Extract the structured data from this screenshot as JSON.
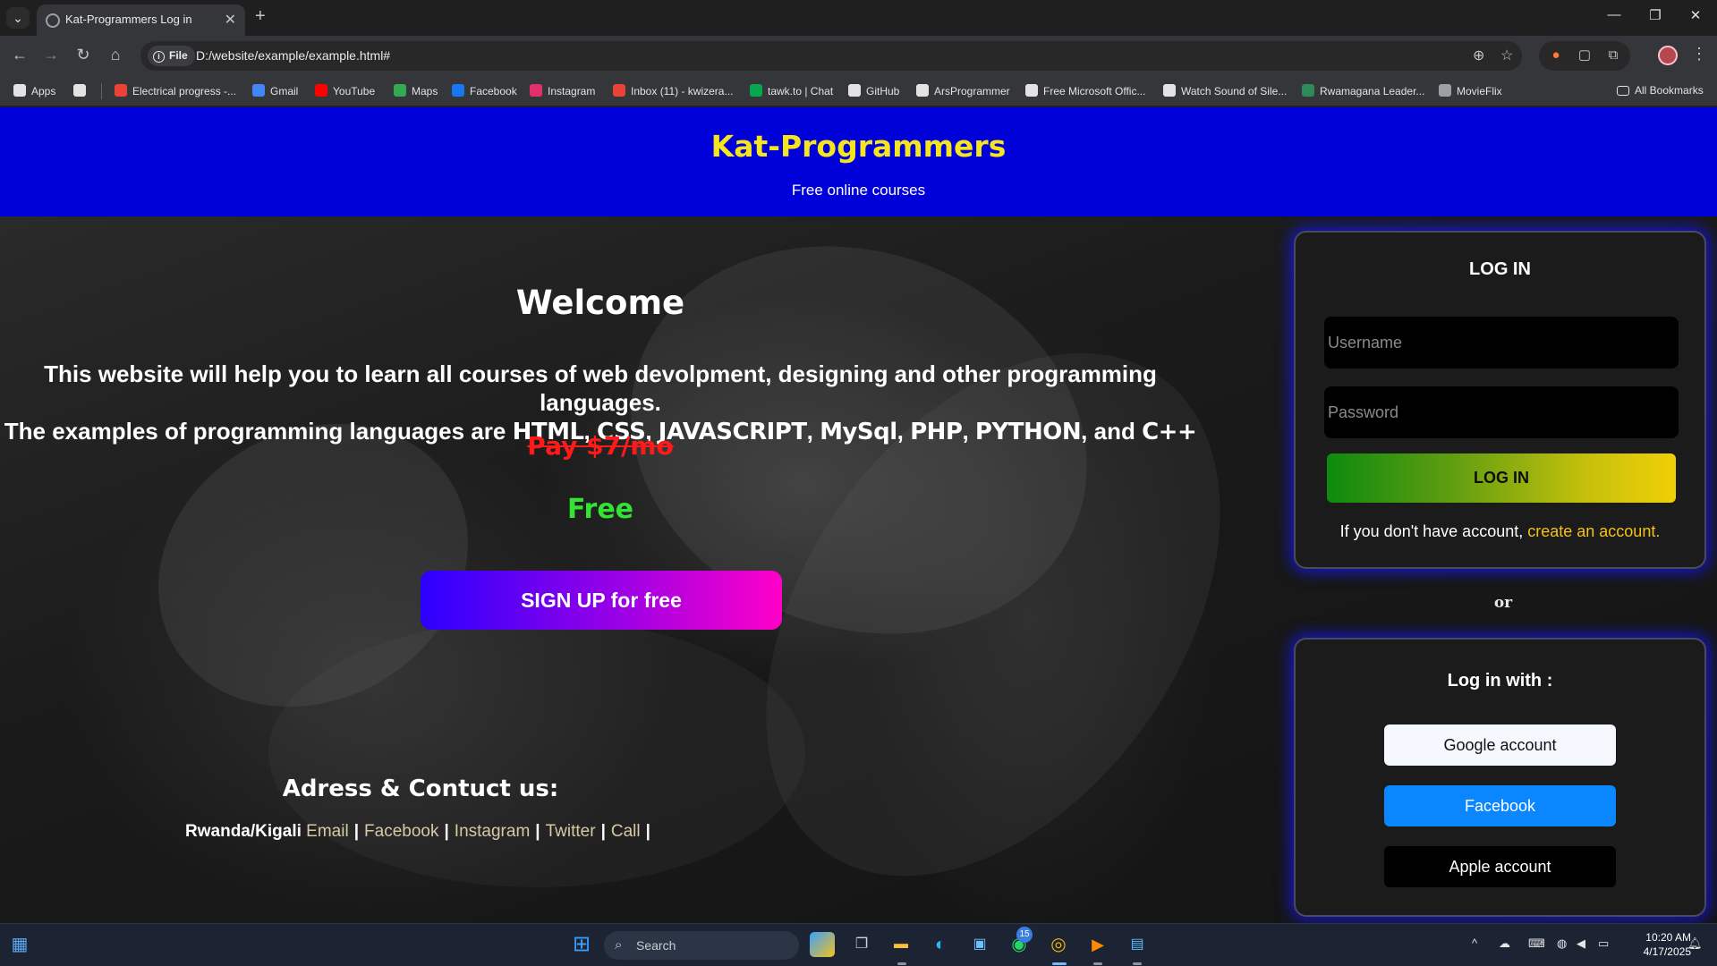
{
  "browser": {
    "tab_title": "Kat-Programmers Log in",
    "tab_close": "✕",
    "new_tab": "+",
    "chip_label": "File",
    "url": "D:/website/example/example.html#",
    "window_controls": [
      "—",
      "❐",
      "✕"
    ],
    "bookmarks": [
      {
        "label": "Apps",
        "icon": "apps-grid-icon",
        "color": "#e3e3e3"
      },
      {
        "label": "",
        "icon": "tab-groups-icon",
        "color": "#e3e3e3"
      },
      {
        "label": "Electrical progress -...",
        "icon": "gmail-icon",
        "color": "#ea4335"
      },
      {
        "label": "Gmail",
        "icon": "google-icon",
        "color": "#4285f4"
      },
      {
        "label": "YouTube",
        "icon": "youtube-icon",
        "color": "#ff0000"
      },
      {
        "label": "Maps",
        "icon": "maps-icon",
        "color": "#34a853"
      },
      {
        "label": "Facebook",
        "icon": "facebook-icon",
        "color": "#1877f2"
      },
      {
        "label": "Instagram",
        "icon": "instagram-icon",
        "color": "#e1306c"
      },
      {
        "label": "Inbox (11) - kwizera...",
        "icon": "gmail-icon",
        "color": "#ea4335"
      },
      {
        "label": "tawk.to | Chat",
        "icon": "tawk-icon",
        "color": "#03a84e"
      },
      {
        "label": "GitHub",
        "icon": "github-icon",
        "color": "#e3e3e3"
      },
      {
        "label": "ArsProgrammer",
        "icon": "arsprogrammer-icon",
        "color": "#e3e3e3"
      },
      {
        "label": "Free Microsoft Offic...",
        "icon": "office-icon",
        "color": "#e3e3e3"
      },
      {
        "label": "Watch Sound of Sile...",
        "icon": "globe-icon",
        "color": "#e3e3e3"
      },
      {
        "label": "Rwamagana Leader...",
        "icon": "rwamagana-icon",
        "color": "#2e8b57"
      },
      {
        "label": "MovieFlix",
        "icon": "movieflix-icon",
        "color": "#9aa0a6"
      }
    ],
    "all_bookmarks": "All Bookmarks"
  },
  "header": {
    "title": "Kat-Programmers",
    "subtitle": "Free online courses",
    "background": "#0000d8",
    "title_color": "#f5e51e"
  },
  "hero": {
    "welcome": "Welcome",
    "desc_line1": "This website will help you to learn all courses of web devolpment, designing and other programming languages.",
    "desc_line2_prefix": "The examples of programming languages are ",
    "languages": [
      "HTML",
      "CSS",
      "JAVASCRIPT",
      "MySql",
      "PHP",
      "PYTHON",
      "C++"
    ],
    "comma": ", ",
    "and_text": ", and ",
    "old_price": "Pay $7/mo",
    "new_price": "Free",
    "signup_label": "SIGN UP for free"
  },
  "contact": {
    "title": "Adress & Contuct us:",
    "location": "Rwanda/Kigali",
    "links": [
      "Email",
      "Facebook",
      "Instagram",
      "Twitter",
      "Call"
    ],
    "separator": "|"
  },
  "login": {
    "title": "LOG IN",
    "username_placeholder": "Username",
    "password_placeholder": "Password",
    "button_label": "LOG IN",
    "no_account_text": "If you don't have account, ",
    "create_link": "create an account."
  },
  "or_text": "or",
  "social": {
    "title": "Log in with :",
    "google": "Google account",
    "facebook": "Facebook",
    "apple": "Apple account"
  },
  "taskbar": {
    "search_label": "Search",
    "whatsapp_badge": "15",
    "time": "10:20 AM",
    "date": "4/17/2025"
  }
}
